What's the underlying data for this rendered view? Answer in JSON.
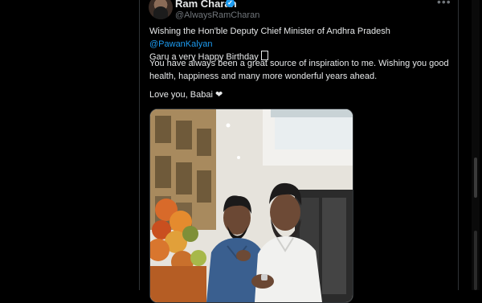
{
  "tweet": {
    "author_name": "Ram Charan",
    "author_handle": "@AlwaysRamCharan",
    "line1_prefix": "Wishing the Hon'ble Deputy Chief Minister of Andhra Pradesh ",
    "mention": "@PawanKalyan",
    "line2": "Garu a very Happy Birthday ",
    "paragraph2": "You have always been a great source of inspiration to me. Wishing you good health, happiness and many more wonderful years ahead.",
    "paragraph3": "Love you, Babai ❤",
    "more_label": "•••",
    "verified_glyph": "✓"
  },
  "colors": {
    "background": "#000000",
    "text": "#e7e9ea",
    "secondary_text": "#71767b",
    "link": "#1d9bf0",
    "verified": "#1d9bf0"
  },
  "icons": [
    "verified-badge-icon",
    "more-icon"
  ],
  "media": {
    "type": "photo"
  }
}
